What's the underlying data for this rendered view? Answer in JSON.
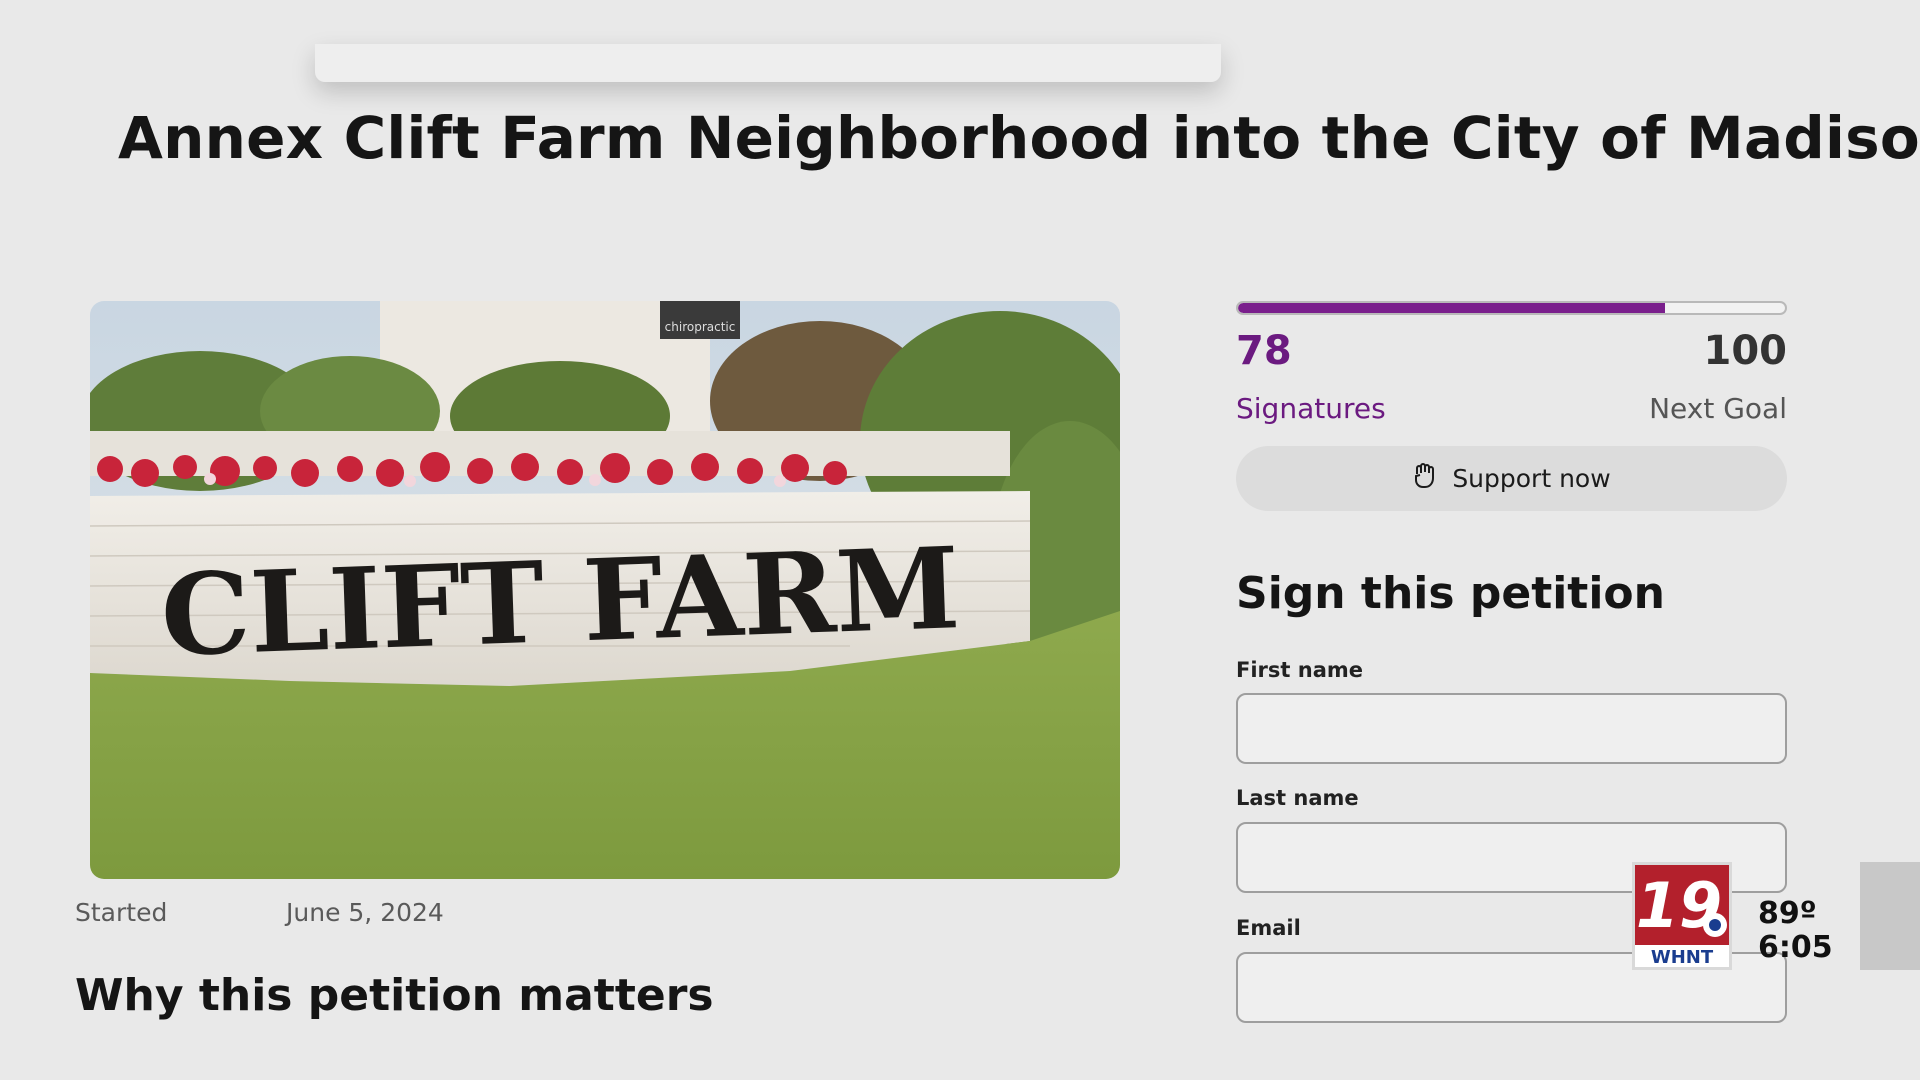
{
  "page": {
    "title": "Annex Clift Farm Neighborhood into the City of Madison",
    "hero_image": {
      "sign_text": "CLIFT FARM",
      "sign_top_text": "chiropractic"
    },
    "started_label": "Started",
    "started_date": "June 5, 2024",
    "section_heading": "Why this petition matters"
  },
  "progress": {
    "signatures": "78",
    "signatures_label": "Signatures",
    "goal": "100",
    "goal_label": "Next Goal",
    "fraction": 0.78,
    "fill_color": "#7a1f8c"
  },
  "support_button": {
    "label": "Support now",
    "icon": "raised-fist-icon"
  },
  "sign_form": {
    "heading": "Sign this petition",
    "first_name_label": "First name",
    "first_name_value": "",
    "last_name_label": "Last name",
    "last_name_value": "",
    "email_label": "Email",
    "email_value": ""
  },
  "tv_overlay": {
    "channel_number": "19",
    "station": "WHNT",
    "temperature": "89º",
    "time": "6:05",
    "brand_color": "#b3202c"
  }
}
